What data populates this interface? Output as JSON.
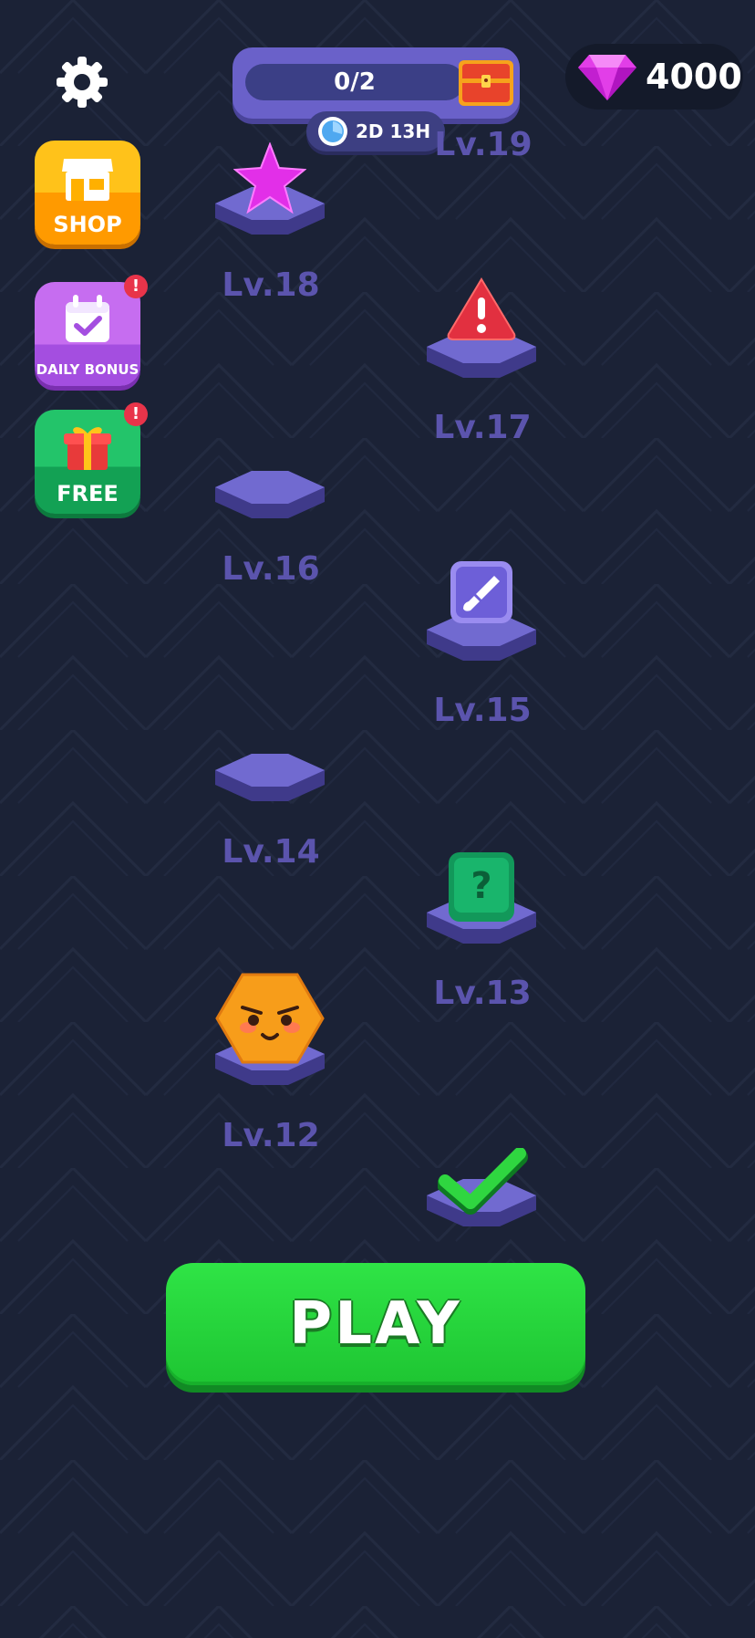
{
  "colors": {
    "background": "#1b2236",
    "accent_purple": "#6a61c9",
    "level_label": "#5b54ad",
    "play_green": "#22cc38",
    "gem_pink": "#e23ee8"
  },
  "header": {
    "settings_icon": "gear-icon",
    "chest_progress": "0/2",
    "chest_progress_fraction": 0,
    "chest_icon": "treasure-chest-icon",
    "timer_icon": "clock-icon",
    "timer": "2D 13H",
    "gem_icon": "gem-icon",
    "gems": "4000"
  },
  "sidebar": {
    "items": [
      {
        "label": "SHOP",
        "icon": "shop-icon"
      },
      {
        "label": "DAILY BONUS",
        "icon": "calendar-check-icon",
        "badge": "!"
      },
      {
        "label": "FREE",
        "icon": "gift-icon",
        "badge": "!"
      }
    ]
  },
  "levels": [
    {
      "label": "Lv.19"
    },
    {
      "label": "Lv.18",
      "reward": "pink-star-icon"
    },
    {
      "label": "Lv.17",
      "reward": "warning-triangle-icon"
    },
    {
      "label": "Lv.16"
    },
    {
      "label": "Lv.15",
      "reward": "paintbrush-icon"
    },
    {
      "label": "Lv.14"
    },
    {
      "label": "Lv.13",
      "reward": "mystery-box-icon"
    },
    {
      "label": "Lv.12",
      "reward": "hexagon-character-icon"
    },
    {
      "label": "",
      "reward": "checkmark-icon"
    }
  ],
  "play": {
    "label": "PLAY"
  }
}
